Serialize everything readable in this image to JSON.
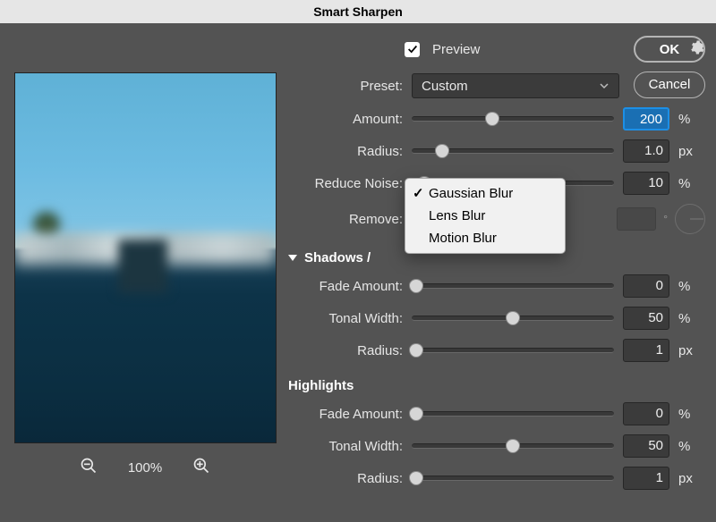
{
  "title": "Smart Sharpen",
  "buttons": {
    "ok": "OK",
    "cancel": "Cancel"
  },
  "preview": {
    "label": "Preview",
    "checked": true
  },
  "preset": {
    "label": "Preset:",
    "value": "Custom"
  },
  "amount": {
    "label": "Amount:",
    "value": "200",
    "unit": "%",
    "slider": 40
  },
  "radius": {
    "label": "Radius:",
    "value": "1.0",
    "unit": "px",
    "slider": 15
  },
  "reduce_noise": {
    "label": "Reduce Noise:",
    "value": "10",
    "unit": "%",
    "slider": 6
  },
  "remove": {
    "label": "Remove:",
    "options": [
      "Gaussian Blur",
      "Lens Blur",
      "Motion Blur"
    ],
    "selected": 0,
    "angle_unit": "°"
  },
  "shadows": {
    "title": "Shadows /",
    "fade": {
      "label": "Fade Amount:",
      "value": "0",
      "unit": "%",
      "slider": 2
    },
    "tonal": {
      "label": "Tonal Width:",
      "value": "50",
      "unit": "%",
      "slider": 50
    },
    "radius": {
      "label": "Radius:",
      "value": "1",
      "unit": "px",
      "slider": 2
    }
  },
  "highlights": {
    "title": "Highlights",
    "fade": {
      "label": "Fade Amount:",
      "value": "0",
      "unit": "%",
      "slider": 2
    },
    "tonal": {
      "label": "Tonal Width:",
      "value": "50",
      "unit": "%",
      "slider": 50
    },
    "radius": {
      "label": "Radius:",
      "value": "1",
      "unit": "px",
      "slider": 2
    }
  },
  "zoom": {
    "level": "100%"
  }
}
